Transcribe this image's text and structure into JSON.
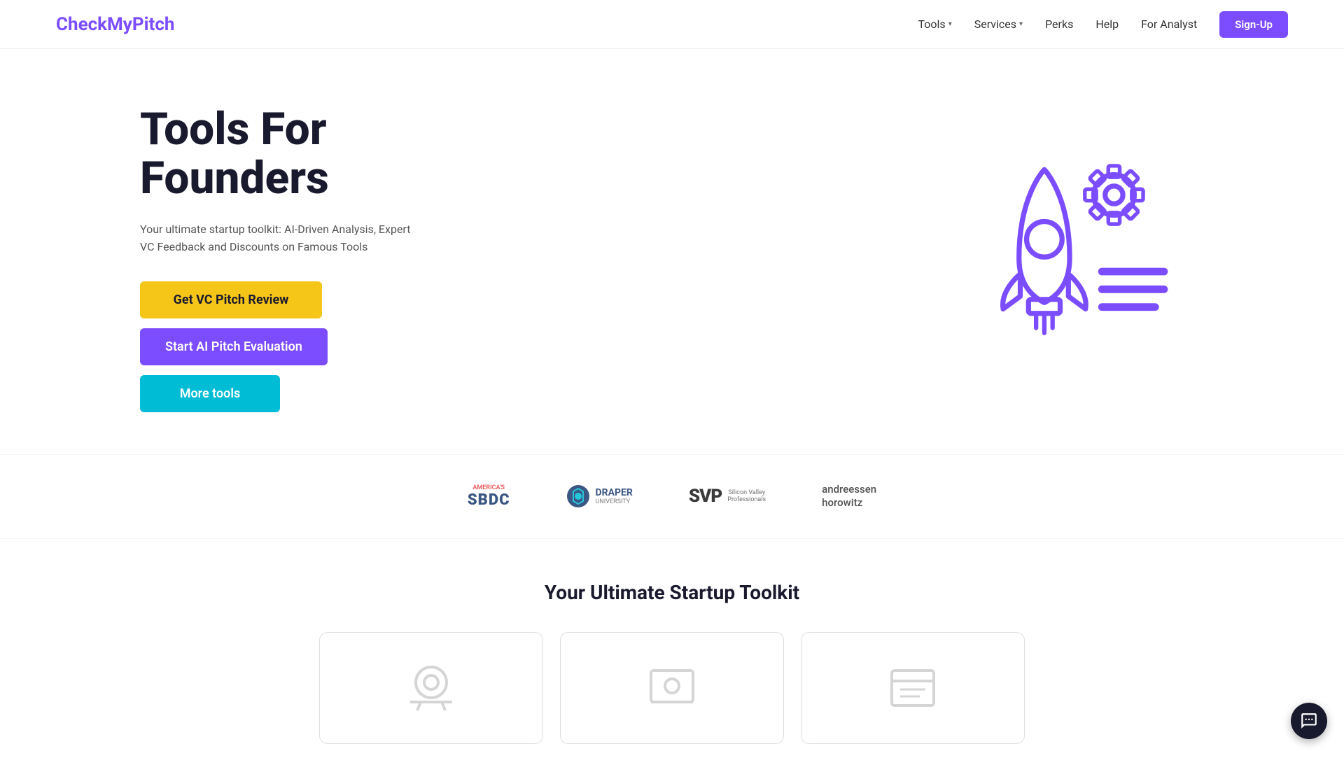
{
  "nav": {
    "logo": "CheckMyPitch",
    "links": [
      {
        "label": "Tools",
        "hasDropdown": true
      },
      {
        "label": "Services",
        "hasDropdown": true
      },
      {
        "label": "Perks",
        "hasDropdown": false
      },
      {
        "label": "Help",
        "hasDropdown": false
      },
      {
        "label": "For Analyst",
        "hasDropdown": false
      }
    ],
    "signup_label": "Sign-Up"
  },
  "hero": {
    "title_line1": "Tools For",
    "title_line2": "Founders",
    "subtitle": "Your ultimate startup toolkit: AI-Driven Analysis, Expert VC Feedback and Discounts on Famous Tools",
    "btn_vc": "Get VC Pitch Review",
    "btn_ai": "Start AI Pitch Evaluation",
    "btn_more": "More tools"
  },
  "partners": [
    {
      "id": "sbdc",
      "name": "America's SBDC"
    },
    {
      "id": "draper",
      "name": "Draper University"
    },
    {
      "id": "svp",
      "name": "SVP Silicon Valley Professionals"
    },
    {
      "id": "ah",
      "name": "andreessen horowitz"
    }
  ],
  "toolkit": {
    "title": "Your Ultimate Startup Toolkit",
    "cards": [
      {
        "id": "card1"
      },
      {
        "id": "card2"
      },
      {
        "id": "card3"
      }
    ]
  },
  "colors": {
    "purple": "#7c4dff",
    "yellow": "#f5c518",
    "cyan": "#00bcd4",
    "dark": "#1a1a2e"
  }
}
